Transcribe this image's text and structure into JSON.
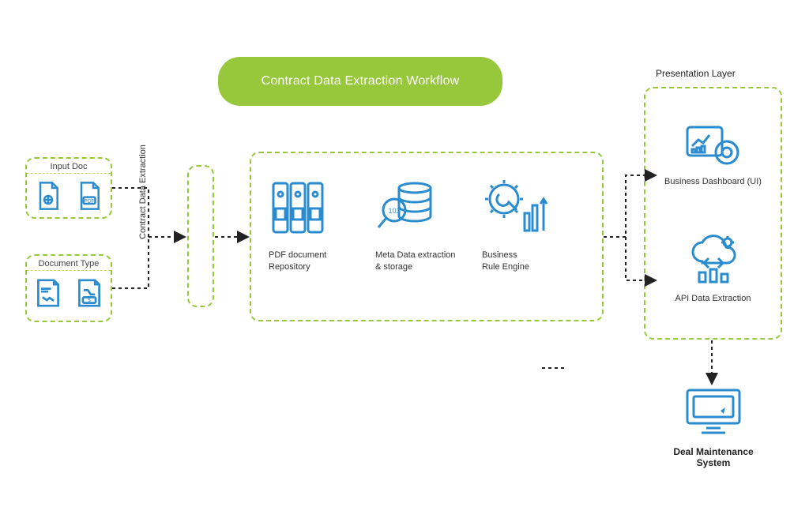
{
  "title": "Contract Data Extraction Workflow",
  "input_doc": {
    "header": "Input Doc"
  },
  "document_type": {
    "header": "Document Type"
  },
  "vertical_label": "Contract Data Extraction",
  "repo": {
    "label_l1": "PDF document",
    "label_l2": "Repository"
  },
  "meta": {
    "label_l1": "Meta Data extraction",
    "label_l2": "& storage"
  },
  "rule": {
    "label_l1": "Business",
    "label_l2": "Rule Engine"
  },
  "presentation": {
    "header": "Presentation Layer",
    "dashboard": "Business Dashboard (UI)",
    "api": "API Data Extraction"
  },
  "deal": "Deal Maintenance System",
  "colors": {
    "green": "#97c83c",
    "blue": "#2a8ccf"
  }
}
